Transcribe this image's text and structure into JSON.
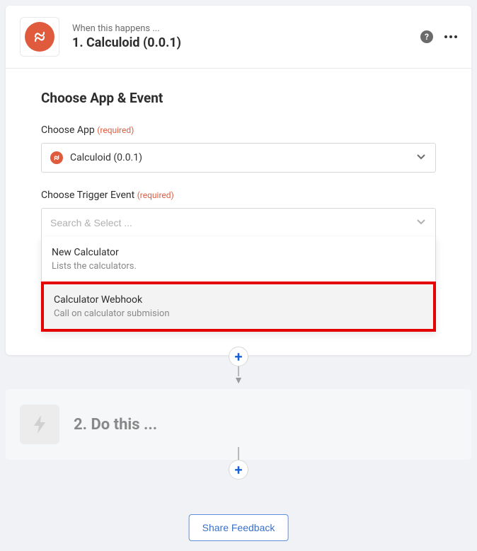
{
  "step1": {
    "subtitle": "When this happens ...",
    "title": "1. Calculoid (0.0.1)",
    "section_title": "Choose App & Event",
    "choose_app": {
      "label": "Choose App",
      "required": "(required)",
      "value": "Calculoid (0.0.1)"
    },
    "choose_event": {
      "label": "Choose Trigger Event",
      "required": "(required)",
      "placeholder": "Search & Select ...",
      "options": [
        {
          "title": "New Calculator",
          "desc": "Lists the calculators."
        },
        {
          "title": "Calculator Webhook",
          "desc": "Call on calculator submision"
        }
      ]
    }
  },
  "step2": {
    "title": "2. Do this ..."
  },
  "feedback": {
    "label": "Share Feedback"
  }
}
